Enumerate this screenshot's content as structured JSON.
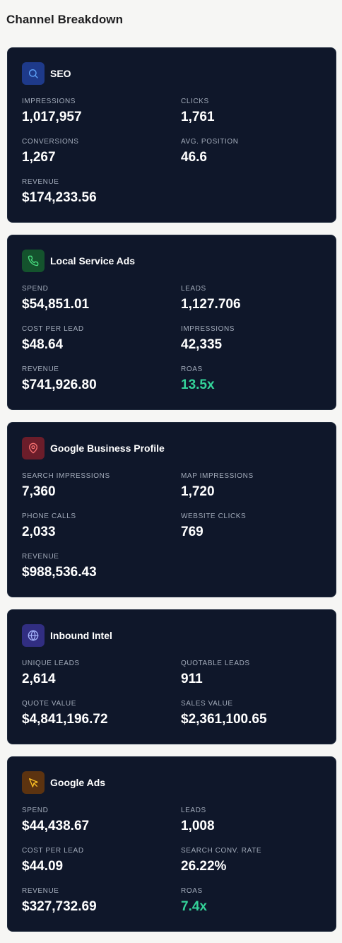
{
  "page": {
    "title": "Channel Breakdown"
  },
  "colors": {
    "card_bg": "#0f172a",
    "positive": "#34d399"
  },
  "channels": [
    {
      "name": "SEO",
      "icon": "search-icon",
      "metrics": [
        {
          "label": "IMPRESSIONS",
          "value": "1,017,957"
        },
        {
          "label": "CLICKS",
          "value": "1,761"
        },
        {
          "label": "CONVERSIONS",
          "value": "1,267"
        },
        {
          "label": "AVG. POSITION",
          "value": "46.6"
        },
        {
          "label": "REVENUE",
          "value": "$174,233.56"
        }
      ]
    },
    {
      "name": "Local Service Ads",
      "icon": "phone-icon",
      "metrics": [
        {
          "label": "SPEND",
          "value": "$54,851.01"
        },
        {
          "label": "LEADS",
          "value": "1,127.706"
        },
        {
          "label": "COST PER LEAD",
          "value": "$48.64"
        },
        {
          "label": "IMPRESSIONS",
          "value": "42,335"
        },
        {
          "label": "REVENUE",
          "value": "$741,926.80"
        },
        {
          "label": "ROAS",
          "value": "13.5x"
        }
      ]
    },
    {
      "name": "Google Business Profile",
      "icon": "map-pin-icon",
      "metrics": [
        {
          "label": "SEARCH IMPRESSIONS",
          "value": "7,360"
        },
        {
          "label": "MAP IMPRESSIONS",
          "value": "1,720"
        },
        {
          "label": "PHONE CALLS",
          "value": "2,033"
        },
        {
          "label": "WEBSITE CLICKS",
          "value": "769"
        },
        {
          "label": "REVENUE",
          "value": "$988,536.43"
        }
      ]
    },
    {
      "name": "Inbound Intel",
      "icon": "globe-icon",
      "metrics": [
        {
          "label": "UNIQUE LEADS",
          "value": "2,614"
        },
        {
          "label": "QUOTABLE LEADS",
          "value": "911"
        },
        {
          "label": "QUOTE VALUE",
          "value": "$4,841,196.72"
        },
        {
          "label": "SALES VALUE",
          "value": "$2,361,100.65"
        }
      ]
    },
    {
      "name": "Google Ads",
      "icon": "cursor-icon",
      "metrics": [
        {
          "label": "SPEND",
          "value": "$44,438.67"
        },
        {
          "label": "LEADS",
          "value": "1,008"
        },
        {
          "label": "COST PER LEAD",
          "value": "$44.09"
        },
        {
          "label": "SEARCH CONV. RATE",
          "value": "26.22%"
        },
        {
          "label": "REVENUE",
          "value": "$327,732.69"
        },
        {
          "label": "ROAS",
          "value": "7.4x"
        }
      ]
    }
  ]
}
